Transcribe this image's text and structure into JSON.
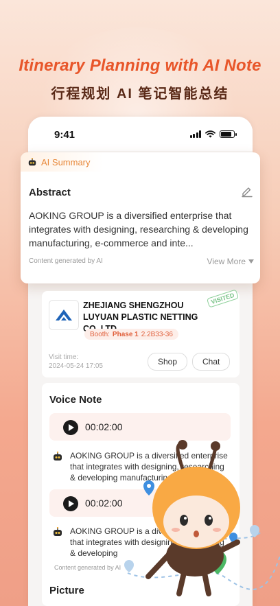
{
  "headline": {
    "en": "Itinerary Planning with AI Note",
    "cn": "行程规划 AI 笔记智能总结"
  },
  "status_bar": {
    "time": "9:41"
  },
  "ai_summary": {
    "tag": "AI Summary",
    "title": "Abstract",
    "text": "AOKING GROUP is a diversified enterprise that integrates with designing, researching & developing manufacturing, e-commerce and inte...",
    "footnote": "Content generated by AI",
    "view_more": "View More"
  },
  "company": {
    "name": "ZHEJIANG SHENGZHOU LUYUAN PLASTIC NETTING CO.,LTD.",
    "booth_label": "Booth:",
    "booth_phase": "Phase 1",
    "booth_code": "2.2B33-36",
    "stamp": "VISITED",
    "visit_label": "Visit time:",
    "visit_time": "2024-05-24 17:05",
    "shop_label": "Shop",
    "chat_label": "Chat"
  },
  "voice_note": {
    "title": "Voice Note",
    "recordings": [
      {
        "duration": "00:02:00",
        "summary": "AOKING GROUP is a diversified enterprise that integrates with designing, researching & developing manufacturing"
      },
      {
        "duration": "00:02:00",
        "summary": "AOKING GROUP is a diversified enterprise that integrates with designing, researching & developing"
      }
    ],
    "footnote": "Content generated by AI",
    "next_section": "Picture"
  },
  "colors": {
    "accent": "#e8562a",
    "ai_orange": "#e8883a",
    "visited_green": "#7bc489"
  },
  "icons": [
    "robot-icon",
    "edit-icon",
    "caret-down-icon",
    "play-icon",
    "signal-icon",
    "wifi-icon",
    "battery-icon",
    "location-pin-icon"
  ]
}
